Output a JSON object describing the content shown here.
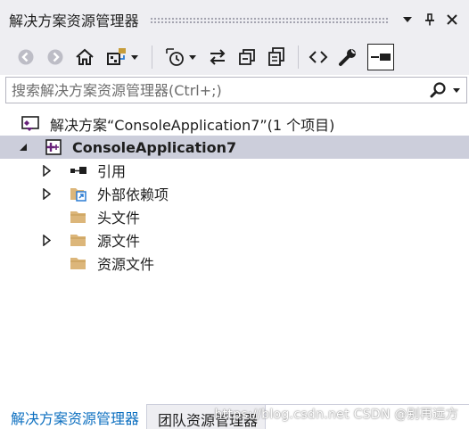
{
  "window": {
    "title": "解决方案资源管理器",
    "controls": [
      "dropdown-icon",
      "pin-icon",
      "close-icon"
    ]
  },
  "toolbar": {
    "items": [
      "back-icon",
      "forward-icon",
      "home-icon",
      "switch-views-icon",
      "pending-changes-filter-icon",
      "sync-icon",
      "collapse-all-icon",
      "show-all-files-icon",
      "view-code-icon",
      "properties-icon",
      "preview-selected-items-icon"
    ]
  },
  "search": {
    "placeholder": "搜索解决方案资源管理器(Ctrl+;)"
  },
  "tree": {
    "solution": "解决方案“ConsoleApplication7”(1 个项目)",
    "project": "ConsoleApplication7",
    "items": [
      {
        "label": "引用",
        "icon": "references-icon",
        "expandable": true
      },
      {
        "label": "外部依赖项",
        "icon": "external-dependencies-icon",
        "expandable": true
      },
      {
        "label": "头文件",
        "icon": "folder-icon",
        "expandable": false
      },
      {
        "label": "源文件",
        "icon": "folder-icon",
        "expandable": true
      },
      {
        "label": "资源文件",
        "icon": "folder-icon",
        "expandable": false
      }
    ]
  },
  "tabs": {
    "active": "解决方案资源管理器",
    "inactive": "团队资源管理器"
  },
  "watermark": "https://blog.csdn.net  CSDN @别再远方",
  "colors": {
    "chrome": "#eeeef2",
    "selection": "#cccedb",
    "accent": "#0e70c0",
    "vs_purple": "#68217a"
  }
}
